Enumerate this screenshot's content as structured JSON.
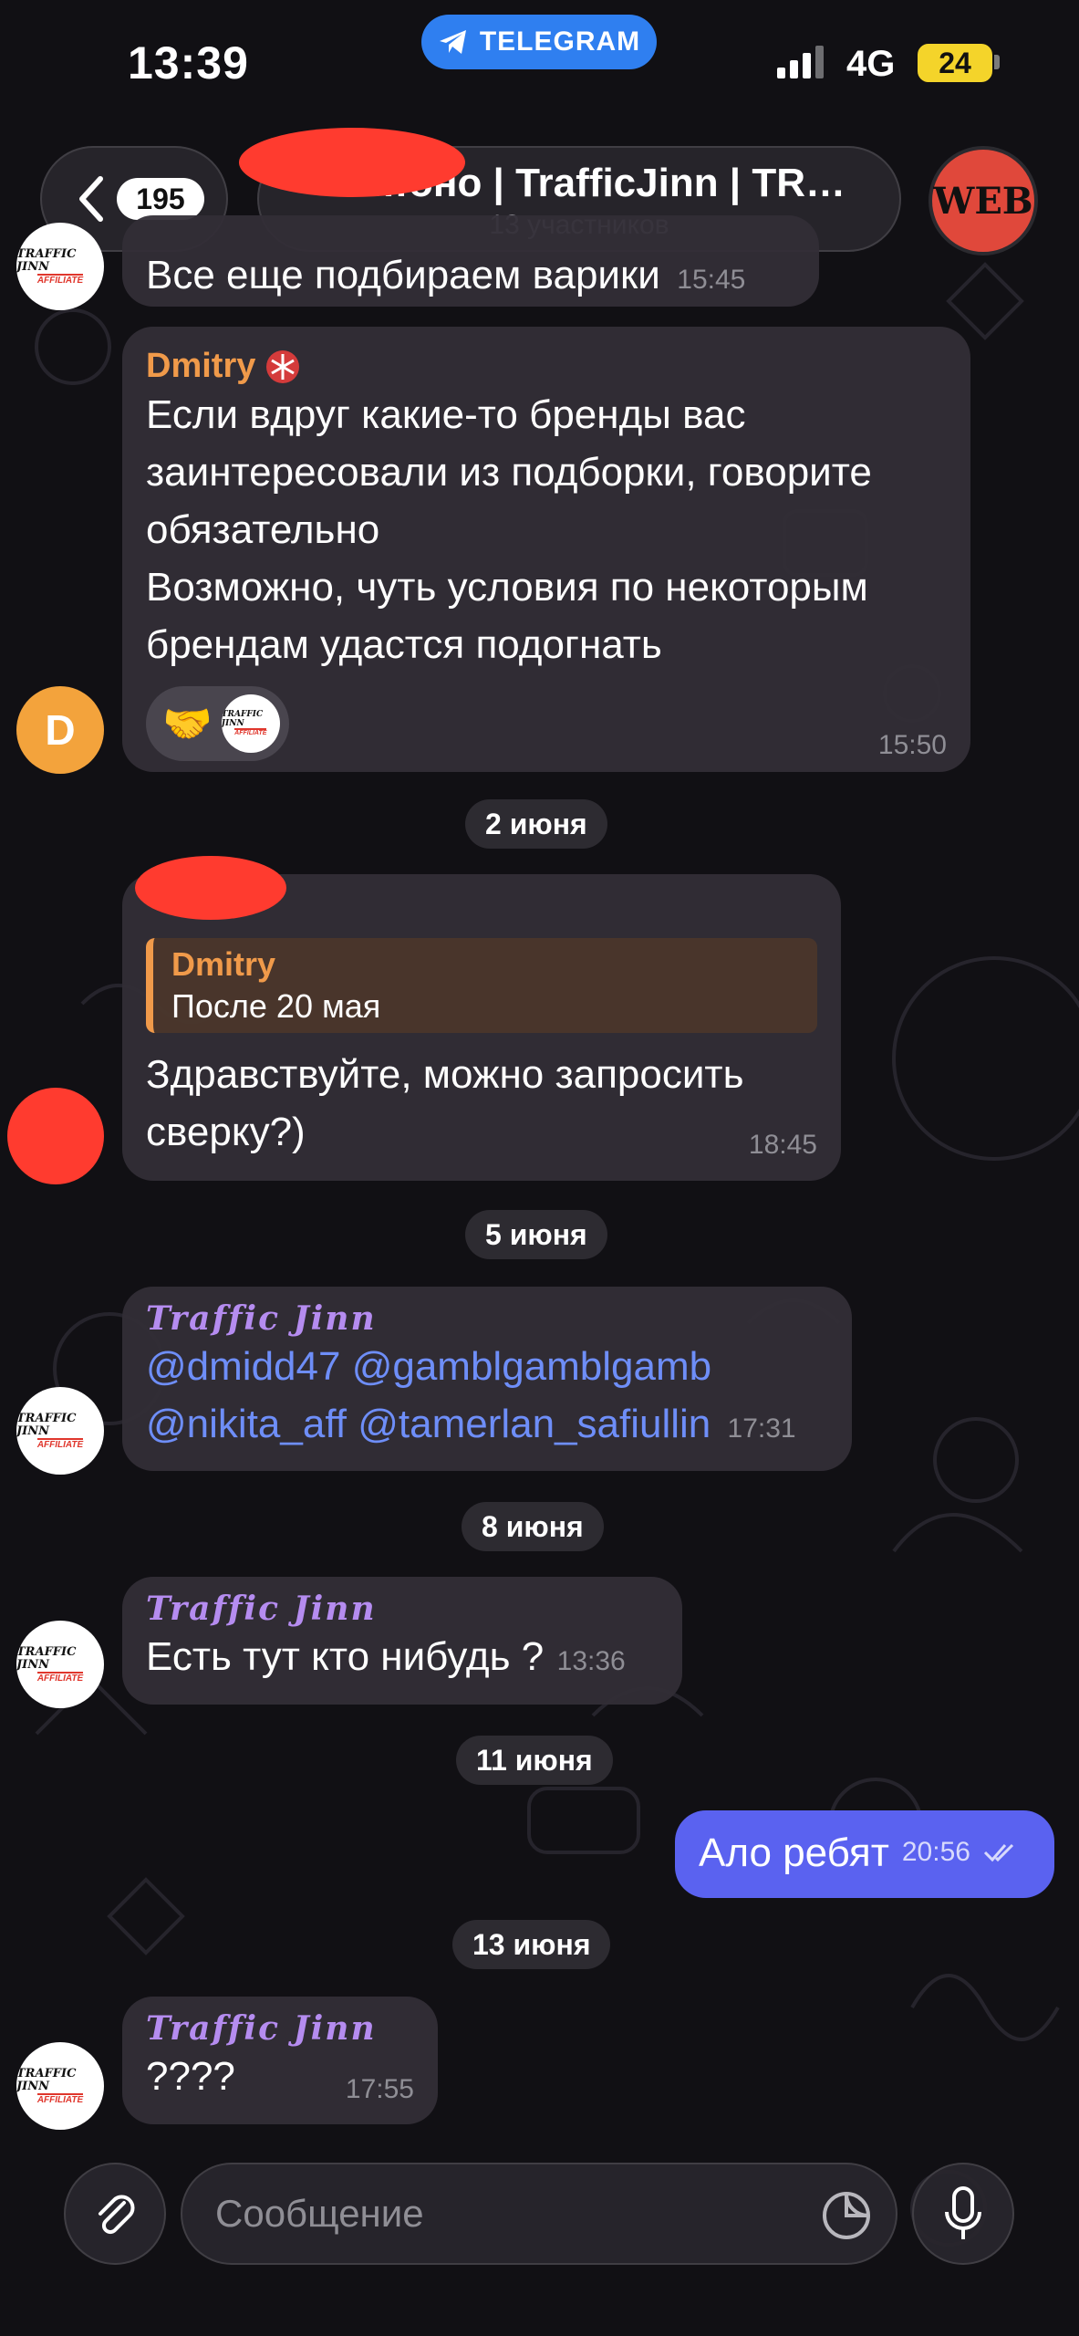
{
  "status_bar": {
    "time": "13:39",
    "app_pill": "TELEGRAM",
    "network": "4G",
    "battery": "24"
  },
  "header": {
    "back_count": "195",
    "title": "…оно | TrafficJinn | TRAFF…",
    "subtitle": "13 участников",
    "group_avatar_text": "WEB"
  },
  "messages": {
    "m0": {
      "text": "Все еще подбираем варики",
      "time": "15:45"
    },
    "m1": {
      "sender": "Dmitry",
      "text1": "Если вдруг какие-то бренды вас",
      "text2": "заинтересовали из подборки, говорите",
      "text3": "обязательно",
      "text4": "Возможно, чуть условия по некоторым",
      "text5": "брендам удастся подогнать",
      "time": "15:50",
      "avatar_letter": "D",
      "reaction_emoji": "🤝"
    },
    "date1": "2 июня",
    "m2": {
      "quote_name": "Dmitry",
      "quote_text": "После 20 мая",
      "text1": "Здравствуйте, можно запросить",
      "text2": "сверку?)",
      "time": "18:45"
    },
    "date2": "5 июня",
    "m3": {
      "sender": "Traffic Jinn",
      "mention1": "@dmidd47",
      "mention2": "@gamblgamblgamb",
      "mention3": "@nikita_aff",
      "mention4": "@tamerlan_safiullin",
      "time": "17:31"
    },
    "date3": "8 июня",
    "m4": {
      "sender": "Traffic Jinn",
      "text": "Есть тут кто нибудь ?",
      "time": "13:36"
    },
    "date4": "11 июня",
    "m5": {
      "text": "Ало ребят",
      "time": "20:56"
    },
    "date5": "13 июня",
    "m6": {
      "sender": "Traffic Jinn",
      "text": "????",
      "time": "17:55"
    }
  },
  "avatar_logo": {
    "top": "TRAFFIC JINN",
    "bottom": "AFFILIATE"
  },
  "input": {
    "placeholder": "Сообщение"
  },
  "colors": {
    "accent": "#2f7ff0",
    "outgoing_bubble": "#5a62f0",
    "dmitry_name": "#f09a4a",
    "traffic_jinn_name": "#b58cf0",
    "mention": "#6e8ef8",
    "redaction": "#ff3b2f"
  },
  "icons": [
    "telegram-plane-icon",
    "chevron-left-icon",
    "paperclip-icon",
    "sticker-icon",
    "microphone-icon",
    "double-check-icon",
    "snowflake-icon",
    "handshake-icon"
  ]
}
